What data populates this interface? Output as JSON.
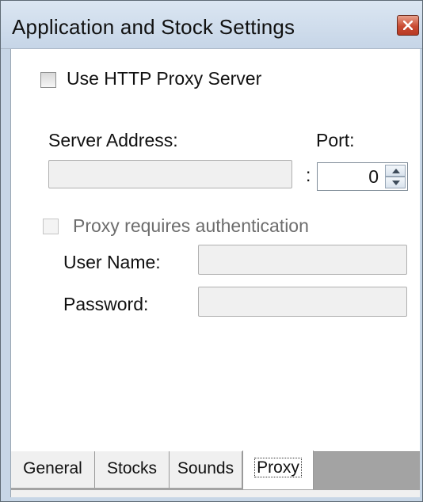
{
  "window": {
    "title": "Application and Stock Settings"
  },
  "proxy": {
    "use_proxy_label": "Use HTTP Proxy Server",
    "use_proxy_checked": false,
    "server_address_label": "Server Address:",
    "server_address_value": "",
    "separator": ":",
    "port_label": "Port:",
    "port_value": "0",
    "auth_label": "Proxy requires authentication",
    "auth_checked": false,
    "username_label": "User Name:",
    "username_value": "",
    "password_label": "Password:",
    "password_value": ""
  },
  "tabs": [
    {
      "label": "General",
      "active": false
    },
    {
      "label": "Stocks",
      "active": false
    },
    {
      "label": "Sounds",
      "active": false
    },
    {
      "label": "Proxy",
      "active": true
    }
  ],
  "colors": {
    "title_bar": "#c6d5e7",
    "close_button": "#c94b32"
  }
}
